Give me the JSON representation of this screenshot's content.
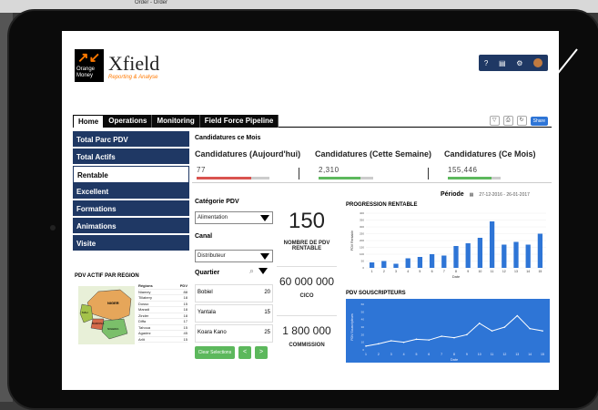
{
  "background": {
    "window_item": "Order - Order"
  },
  "app": {
    "brand": "Xfield",
    "logo_text": "Orange Money",
    "subtitle": "Reporting & Analyse",
    "toolbar_icons": [
      "help-icon",
      "doc-icon",
      "gear-icon",
      "avatar"
    ],
    "help_label": "?"
  },
  "tabs": [
    "Home",
    "Operations",
    "Monitoring",
    "Field Force Pipeline"
  ],
  "share_label": "Share",
  "menu": [
    "Total Parc PDV",
    "Total Actifs",
    "Rentable",
    "Excellent",
    "Formations",
    "Animations",
    "Visite"
  ],
  "map": {
    "title": "PDV ACTIF PAR REGION",
    "headers": [
      "Régions",
      "PDV"
    ],
    "rows": [
      [
        "Niamey",
        "88"
      ],
      [
        "Tillabery",
        "18"
      ],
      [
        "Dosso",
        "15"
      ],
      [
        "Maradi",
        "18"
      ],
      [
        "Zinder",
        "18"
      ],
      [
        "Diffa",
        "17"
      ],
      [
        "Tahoua",
        "15"
      ],
      [
        "Agadez",
        "45"
      ],
      [
        "Arlit",
        "15"
      ]
    ],
    "labels": [
      "NIGER",
      "MALI",
      "BURKINA",
      "NIGERIA"
    ]
  },
  "candidatures": {
    "title": "Candidatures ce Mois",
    "items": [
      {
        "label": "Candidatures (Aujourd'hui)",
        "value": "77"
      },
      {
        "label": "Candidatures (Cette Semaine)",
        "value": "2,310"
      },
      {
        "label": "Candidatures (Ce Mois)",
        "value": "155,446"
      }
    ]
  },
  "periode": {
    "label": "Période",
    "range": "27-12-2016 - 26-01-2017"
  },
  "filters": {
    "categorie_label": "Catégorie PDV",
    "categorie_value": "Alimentation",
    "canal_label": "Canal",
    "canal_value": "Distributeur",
    "quartier_label": "Quartier",
    "quartiers": [
      {
        "name": "Bobiel",
        "count": "20"
      },
      {
        "name": "Yantala",
        "count": "15"
      },
      {
        "name": "Koara Kano",
        "count": "25"
      }
    ],
    "clear_label": "Clear Selections",
    "prev_label": "<",
    "next_label": ">"
  },
  "kpis": {
    "pdv_value": "150",
    "pdv_label": "NOMBRE DE PDV RENTABLE",
    "cico_value": "60 000 000",
    "cico_label": "CICO",
    "commission_value": "1 800 000",
    "commission_label": "COMMISSION"
  },
  "chart_data": [
    {
      "type": "bar",
      "title": "PROGRESSION RENTABLE",
      "xlabel": "Date",
      "ylabel": "PDV Rentable",
      "categories": [
        "1",
        "2",
        "3",
        "4",
        "5",
        "6",
        "7",
        "8",
        "9",
        "10",
        "11",
        "12",
        "13",
        "14",
        "15"
      ],
      "values": [
        40,
        50,
        30,
        70,
        80,
        100,
        90,
        160,
        180,
        220,
        340,
        170,
        190,
        170,
        250
      ],
      "ylim": [
        0,
        400
      ],
      "color": "#2e75d6"
    },
    {
      "type": "line",
      "title": "PDV SOUSCRIPTEURS",
      "xlabel": "Date",
      "ylabel": "PDV Souscripteurs",
      "x": [
        "1",
        "2",
        "3",
        "4",
        "5",
        "6",
        "7",
        "8",
        "9",
        "10",
        "11",
        "12",
        "13",
        "14",
        "15"
      ],
      "values": [
        5,
        8,
        12,
        10,
        14,
        13,
        18,
        16,
        20,
        35,
        25,
        30,
        45,
        28,
        25
      ],
      "ylim": [
        0,
        60
      ],
      "color": "#ffffff"
    }
  ]
}
